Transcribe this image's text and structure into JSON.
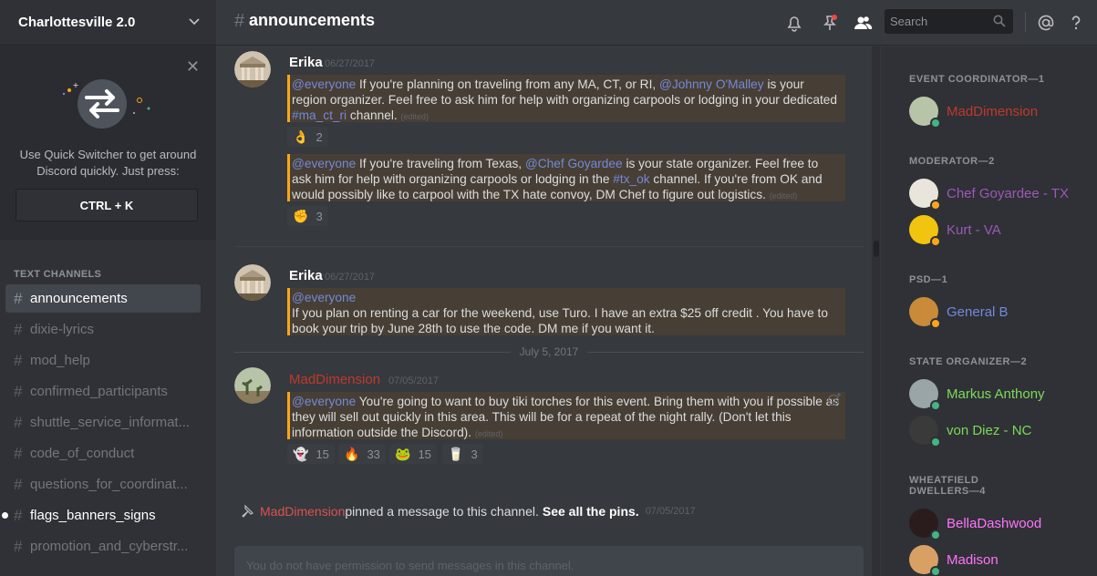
{
  "guild": {
    "name": "Charlottesville 2.0"
  },
  "quick_switcher": {
    "text": "Use Quick Switcher to get around Discord quickly. Just press:",
    "shortcut": "CTRL + K"
  },
  "channels": {
    "title": "TEXT CHANNELS",
    "items": [
      {
        "name": "announcements",
        "state": "active"
      },
      {
        "name": "dixie-lyrics",
        "state": "normal"
      },
      {
        "name": "mod_help",
        "state": "normal"
      },
      {
        "name": "confirmed_participants",
        "state": "normal"
      },
      {
        "name": "shuttle_service_informat...",
        "state": "normal"
      },
      {
        "name": "code_of_conduct",
        "state": "normal"
      },
      {
        "name": "questions_for_coordinat...",
        "state": "normal"
      },
      {
        "name": "flags_banners_signs",
        "state": "unread"
      },
      {
        "name": "promotion_and_cyberstr...",
        "state": "normal"
      }
    ]
  },
  "topbar": {
    "hash": "#",
    "channel": "announcements",
    "search_placeholder": "Search",
    "icons": [
      "bell-icon",
      "pin-icon",
      "members-icon",
      "search-icon",
      "at-icon",
      "help-icon"
    ]
  },
  "messages": {
    "group1": {
      "author": "Erika",
      "timestamp": "06/27/2017",
      "m1": {
        "everyone": "@everyone",
        "text1": " If you're planning on traveling from any MA, CT, or RI, ",
        "user": "@Johnny O'Malley",
        "text2": " is your region organizer. Feel free to ask him for help with organizing carpools or lodging in your dedicated ",
        "channel": "#ma_ct_ri",
        "text3": " channel. ",
        "edited": "(edited)"
      },
      "r1": {
        "emoji": "👌",
        "count": "2"
      },
      "m2": {
        "everyone": "@everyone",
        "text1": " If you're traveling from Texas, ",
        "user": "@Chef Goyardee",
        "text2": " is your state organizer. Feel free to ask him for help with organizing carpools or lodging in the ",
        "channel": "#tx_ok",
        "text3": " channel. If you're from OK and would possibly like to carpool with the TX hate convoy, DM Chef to figure out logistics. ",
        "edited": "(edited)"
      },
      "r2": {
        "emoji": "✊",
        "count": "3"
      }
    },
    "group2": {
      "author": "Erika",
      "timestamp": "06/27/2017",
      "everyone": "@everyone",
      "text": "If you plan on renting a car for the weekend, use Turo. I have an extra $25 off credit . You have to book your trip by June 28th to use the code. DM me if you want it."
    },
    "date_separator": "July 5, 2017",
    "group3": {
      "author": "MadDimension",
      "timestamp": "07/05/2017",
      "everyone": "@everyone",
      "text": " You're going to want to buy tiki torches for this event. Bring them with you if possible as they will sell out quickly in this area. This will be for a repeat of the night rally. (Don't let this information outside the Discord). ",
      "edited": "(edited)",
      "reactions": [
        {
          "emoji": "👻",
          "count": "15"
        },
        {
          "emoji": "🔥",
          "count": "33"
        },
        {
          "emoji": "🐸",
          "count": "15"
        },
        {
          "emoji": "🥛",
          "count": "3"
        }
      ]
    },
    "system": {
      "user": "MadDimension",
      "text": " pinned a message to this channel.",
      "link": "See all the pins.",
      "timestamp": "07/05/2017"
    }
  },
  "composer": {
    "placeholder": "You do not have permission to send messages in this channel."
  },
  "members": {
    "roles": [
      {
        "title": "EVENT COORDINATOR—1",
        "members": [
          {
            "name": "MadDimension",
            "color": "#c0392b",
            "status": "#43b581"
          }
        ]
      },
      {
        "title": "MODERATOR—2",
        "members": [
          {
            "name": "Chef Goyardee - TX",
            "color": "#9b59b6",
            "status": "#faa61a"
          },
          {
            "name": "Kurt - VA",
            "color": "#9b59b6",
            "status": "#faa61a"
          }
        ]
      },
      {
        "title": "PSD—1",
        "members": [
          {
            "name": "General B",
            "color": "#7289da",
            "status": "#faa61a"
          }
        ]
      },
      {
        "title": "STATE ORGANIZER—2",
        "members": [
          {
            "name": "Markus Anthony",
            "color": "#7ed957",
            "status": "#43b581"
          },
          {
            "name": "von Diez - NC",
            "color": "#7ed957",
            "status": "#43b581"
          }
        ]
      },
      {
        "title_l1": "WHEATFIELD",
        "title_l2": "DWELLERS—4",
        "members": [
          {
            "name": "BellaDashwood",
            "color": "#ff73fa",
            "status": "#43b581"
          },
          {
            "name": "Madison",
            "color": "#ff73fa",
            "status": "#43b581"
          }
        ]
      }
    ]
  }
}
